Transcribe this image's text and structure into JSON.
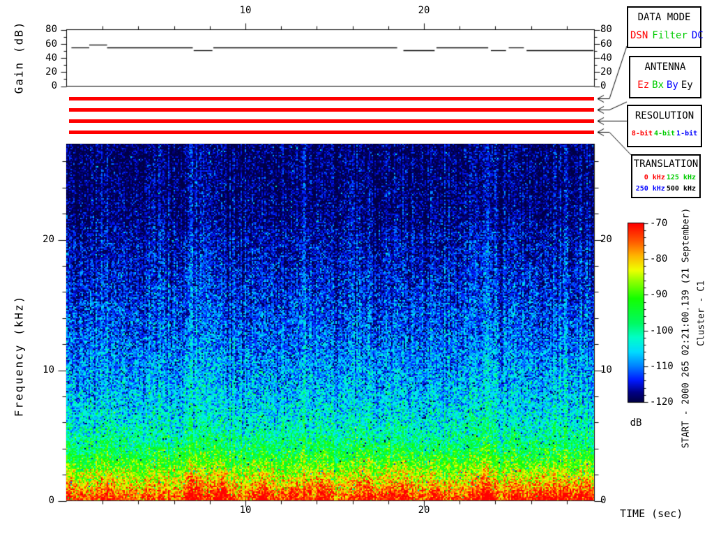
{
  "colors": {
    "red": "#FF0000",
    "green": "#00CC00",
    "blue": "#0000FF",
    "black": "#000000",
    "bar_color": "#FF0000"
  },
  "gain_plot": {
    "ylabel": "Gain (dB)",
    "y_tick_labels": [
      "80",
      "60",
      "40",
      "20",
      "0"
    ],
    "top_tick_labels": [
      "10",
      "20"
    ]
  },
  "spectrogram_plot": {
    "ylabel": "Frequency (kHz)",
    "xlabel": "TIME (sec)",
    "y_tick_labels": [
      "20",
      "10",
      "0"
    ],
    "x_tick_labels": [
      "10",
      "20"
    ]
  },
  "colorbar": {
    "tick_labels": [
      "-70",
      "-80",
      "-90",
      "-100",
      "-110",
      "-120"
    ],
    "unit": "dB"
  },
  "side_text": {
    "start": "START - 2000 265 02:21:00.139 (21 September)",
    "cluster": "Cluster - C1"
  },
  "legend_boxes": [
    {
      "title": "DATA MODE",
      "values": [
        {
          "label": "DSN",
          "color": "#FF0000"
        },
        {
          "label": "Filter",
          "color": "#00CC00"
        },
        {
          "label": "DC",
          "color": "#0000FF"
        }
      ]
    },
    {
      "title": "ANTENNA",
      "values": [
        {
          "label": "Ez",
          "color": "#FF0000"
        },
        {
          "label": "Bx",
          "color": "#00CC00"
        },
        {
          "label": "By",
          "color": "#0000FF"
        },
        {
          "label": "Ey",
          "color": "#000000"
        }
      ]
    },
    {
      "title": "RESOLUTION",
      "values": [
        {
          "label": "8-bit",
          "color": "#FF0000"
        },
        {
          "label": "4-bit",
          "color": "#00CC00"
        },
        {
          "label": "1-bit",
          "color": "#0000FF"
        }
      ]
    },
    {
      "title": "TRANSLATION",
      "rows": [
        [
          {
            "label": "0 kHz",
            "color": "#FF0000"
          },
          {
            "label": "125 kHz",
            "color": "#00CC00"
          }
        ],
        [
          {
            "label": "250 kHz",
            "color": "#0000FF"
          },
          {
            "label": "500 kHz",
            "color": "#000000"
          }
        ]
      ]
    }
  ],
  "status_bars": {
    "count": 4,
    "color": "#FF0000",
    "meaning": [
      "data-mode: DSN",
      "antenna: Ez",
      "resolution: 8-bit",
      "translation: 0 kHz"
    ]
  },
  "chart_data": [
    {
      "type": "line",
      "title": "Receiver gain vs time",
      "ylabel": "Gain (dB)",
      "xlabel": "TIME (sec)",
      "xlim": [
        0,
        29.6
      ],
      "ylim": [
        0,
        80
      ],
      "x_major_ticks": [
        10,
        20
      ],
      "x_minor_tick_step": 2,
      "y_major_ticks": [
        0,
        20,
        40,
        60,
        80
      ],
      "y_minor_ticks": [
        10,
        30,
        50,
        70
      ],
      "grid": false,
      "series": [
        {
          "name": "gain_db",
          "segments_t0_t1_db": [
            [
              0.25,
              1.25,
              54
            ],
            [
              1.25,
              2.25,
              58
            ],
            [
              2.25,
              7.05,
              54
            ],
            [
              7.1,
              8.15,
              50
            ],
            [
              8.2,
              18.5,
              54
            ],
            [
              18.85,
              20.6,
              50
            ],
            [
              20.7,
              23.6,
              54
            ],
            [
              23.75,
              24.6,
              50
            ],
            [
              24.75,
              25.6,
              54
            ],
            [
              25.75,
              29.5,
              50
            ]
          ]
        }
      ]
    },
    {
      "type": "heatmap",
      "title": "Cluster C1 WBD wideband spectrogram",
      "xlabel": "TIME (sec)",
      "ylabel": "Frequency (kHz)",
      "xlim": [
        0,
        29.6
      ],
      "ylim": [
        0,
        27.3
      ],
      "x_major_ticks": [
        10,
        20
      ],
      "x_minor_tick_step": 2,
      "y_major_ticks": [
        0,
        10,
        20
      ],
      "y_minor_tick_step": 2,
      "colorbar": {
        "label": "dB",
        "min": -120,
        "max": -70,
        "major_ticks": [
          -70,
          -80,
          -90,
          -100,
          -110,
          -120
        ],
        "minor_tick_step": 2
      },
      "colormap_stops_db_rgb": [
        [
          -120,
          0,
          0,
          70
        ],
        [
          -117.5,
          0,
          0,
          130
        ],
        [
          -114,
          0,
          25,
          255
        ],
        [
          -110,
          0,
          130,
          255
        ],
        [
          -106,
          0,
          220,
          255
        ],
        [
          -102,
          0,
          255,
          200
        ],
        [
          -98,
          0,
          250,
          100
        ],
        [
          -91,
          20,
          255,
          0
        ],
        [
          -86,
          150,
          255,
          0
        ],
        [
          -83,
          240,
          255,
          0
        ],
        [
          -79,
          255,
          180,
          0
        ],
        [
          -75,
          255,
          90,
          0
        ],
        [
          -70,
          255,
          0,
          0
        ]
      ],
      "noise_profile_khz_db": [
        [
          0,
          -74
        ],
        [
          0.5,
          -76
        ],
        [
          1,
          -80
        ],
        [
          1.5,
          -83
        ],
        [
          2,
          -86
        ],
        [
          3,
          -92
        ],
        [
          4,
          -97
        ],
        [
          5,
          -101
        ],
        [
          6,
          -103.5
        ],
        [
          7,
          -105.5
        ],
        [
          9,
          -108
        ],
        [
          12,
          -111
        ],
        [
          15,
          -113.5
        ],
        [
          18,
          -115.5
        ],
        [
          20.5,
          -117
        ],
        [
          21.5,
          -118.2
        ],
        [
          24,
          -118.8
        ],
        [
          27.4,
          -119.2
        ]
      ],
      "noise_sigma_db_at_0khz": 5.2,
      "noise_sigma_slope_per_khz": -0.07,
      "bursts_t_boost_fscale_full": [
        [
          0.2,
          6,
          1.2,
          0
        ],
        [
          2.3,
          5,
          1.5,
          0
        ],
        [
          7.1,
          8,
          2.5,
          1
        ],
        [
          8.7,
          9,
          2.8,
          0
        ],
        [
          11.0,
          8,
          2.5,
          0
        ],
        [
          12.6,
          5,
          1.5,
          0
        ],
        [
          14.3,
          8,
          2.8,
          0
        ],
        [
          16.8,
          9,
          3.0,
          0
        ],
        [
          18.1,
          6,
          1.8,
          0
        ],
        [
          19.0,
          8,
          2.5,
          0
        ],
        [
          20.6,
          5,
          1.5,
          0
        ],
        [
          23.4,
          9,
          2.8,
          1
        ],
        [
          25.3,
          5,
          1.8,
          0
        ],
        [
          26.5,
          5,
          2.0,
          0
        ],
        [
          27.3,
          6,
          2.2,
          0
        ],
        [
          28.3,
          6,
          2.4,
          0
        ],
        [
          29.2,
          6,
          2.2,
          0
        ]
      ],
      "description": "Broadband noise: intense red/yellow band below ~3 kHz fading through green and cyan to dark navy above ~21 kHz, with vertical burst striations"
    }
  ]
}
